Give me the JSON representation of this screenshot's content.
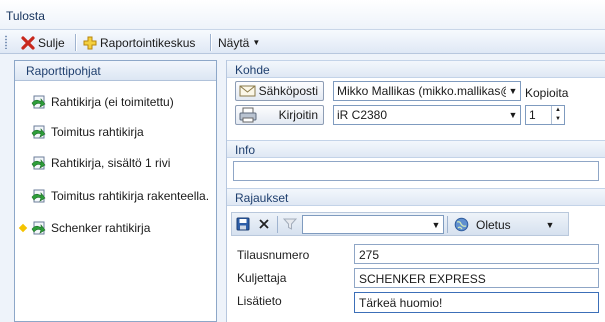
{
  "window": {
    "title": "Tulosta"
  },
  "toolbar": {
    "close_label": "Sulje",
    "reporting_center_label": "Raportointikeskus",
    "view_label": "Näytä"
  },
  "templates": {
    "header": "Raporttipohjat",
    "items": [
      {
        "label": "Rahtikirja (ei toimitettu)"
      },
      {
        "label": "Toimitus rahtikirja"
      },
      {
        "label": "Rahtikirja, sisältö 1 rivi"
      },
      {
        "label": "Toimitus rahtikirja rakenteella."
      },
      {
        "label": "Schenker rahtikirja"
      }
    ]
  },
  "target": {
    "header": "Kohde",
    "email_button": "Sähköposti",
    "printer_button": "Kirjoitin",
    "email_value": "Mikko Mallikas (mikko.mallikas@",
    "printer_value": "iR C2380",
    "copies_label": "Kopioita",
    "copies_value": "1"
  },
  "info": {
    "header": "Info",
    "value": ""
  },
  "filters": {
    "header": "Rajaukset",
    "filter_combo_value": "",
    "layout_value": "Oletus",
    "fields": [
      {
        "label": "Tilausnumero",
        "value": "275"
      },
      {
        "label": "Kuljettaja",
        "value": "SCHENKER EXPRESS"
      },
      {
        "label": "Lisätieto",
        "value": "Tärkeä huomio!"
      }
    ]
  },
  "colors": {
    "accent": "#1f3f6e",
    "border": "#8da7c8",
    "highlight": "#f5c400"
  }
}
